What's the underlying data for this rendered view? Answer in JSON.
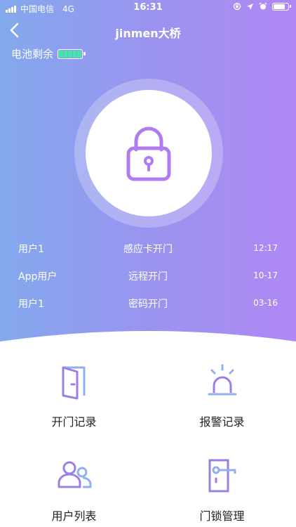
{
  "status_bar": {
    "carrier": "中国电信",
    "network": "4G",
    "time": "16:31"
  },
  "nav": {
    "title": "jinmen大桥"
  },
  "battery_remain": {
    "label": "电池剩余",
    "level_color": "#3fe8a8"
  },
  "lock": {
    "icon": "padlock-icon",
    "color": "#b07cf0"
  },
  "records": [
    {
      "user": "用户1",
      "action": "感应卡开门",
      "time": "12:17"
    },
    {
      "user": "App用户",
      "action": "远程开门",
      "time": "10-17"
    },
    {
      "user": "用户1",
      "action": "密码开门",
      "time": "03-16"
    }
  ],
  "menu": [
    {
      "label": "开门记录",
      "icon": "door-open-icon"
    },
    {
      "label": "报警记录",
      "icon": "alarm-light-icon"
    },
    {
      "label": "用户列表",
      "icon": "users-icon"
    },
    {
      "label": "门锁管理",
      "icon": "door-lock-icon"
    }
  ],
  "colors": {
    "gradient_start": "#83a9ee",
    "gradient_end": "#b088f4",
    "icon_purple": "#9b7fe6",
    "icon_blue": "#8fb0ee"
  }
}
